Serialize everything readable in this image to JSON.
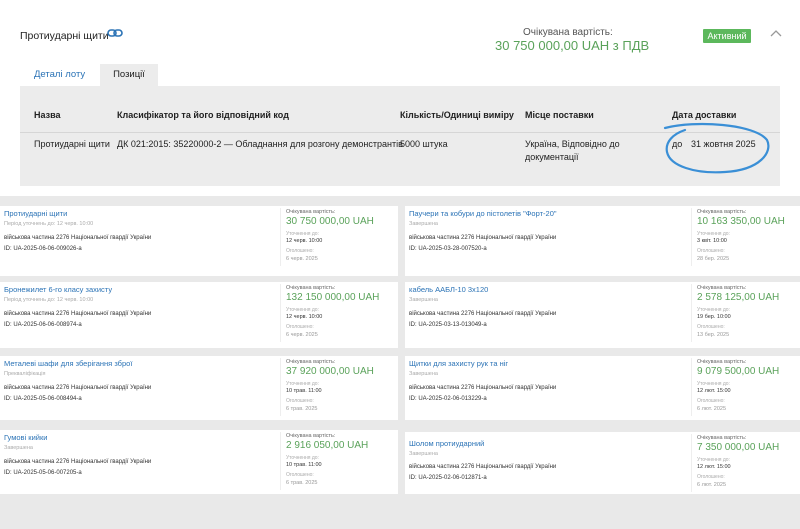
{
  "lot": {
    "title": "Протиударні щити",
    "price_caption": "Очікувана вартість:",
    "price_value": "30 750 000,00 UAH з ПДВ",
    "status": "Активний",
    "tabs": [
      "Деталі лоту",
      "Позиції"
    ],
    "table": {
      "headers": [
        "Назва",
        "Класифікатор та його відповідний код",
        "Кількість/Одиниці виміру",
        "Місце поставки",
        "Дата доставки"
      ],
      "row": {
        "name": "Протиударні щити",
        "classifier": "ДК 021:2015: 35220000-2 — Обладнання для розгону демонстрантів",
        "quantity": "5000 штука",
        "place_line1": "Україна, Відповідно до",
        "place_line2": "документації",
        "date_prefix": "до",
        "date": "31 жовтня 2025"
      }
    }
  },
  "results": [
    {
      "title": "Протиударні щити",
      "subtitle": "Період уточнень до: 12 черв. 10:00",
      "org": "військова частина 2276 Національної гвардії України",
      "id": "ID: UA-2025-06-06-009026-a",
      "price_caption": "Очікувана вартість:",
      "price": "30 750 000,00 UAH",
      "label1": "Уточнення до:",
      "date1": "12 черв. 10:00",
      "label2": "Оголошено:",
      "date2": "6 черв. 2025"
    },
    {
      "title": "Паучери та кобури до пістолетів \"Форт-20\"",
      "subtitle": "Завершена",
      "org": "військова частина 2276 Національної гвардії України",
      "id": "ID: UA-2025-03-28-007520-a",
      "price_caption": "Очікувана вартість:",
      "price": "10 163 350,00 UAH",
      "label1": "Уточнення до:",
      "date1": "3 квіт. 10:00",
      "label2": "Оголошено:",
      "date2": "28 бер. 2025"
    },
    {
      "title": "Бронежилет 6-го класу захисту",
      "subtitle": "Період уточнень до: 12 черв. 10:00",
      "org": "військова частина 2276 Національної гвардії України",
      "id": "ID: UA-2025-06-06-008974-a",
      "price_caption": "Очікувана вартість:",
      "price": "132 150 000,00 UAH",
      "label1": "Уточнення до:",
      "date1": "12 черв. 10:00",
      "label2": "Оголошено:",
      "date2": "6 черв. 2025"
    },
    {
      "title": "кабель ААБЛ-10 3х120",
      "subtitle": "Завершена",
      "org": "військова частина 2276 Національної гвардії України",
      "id": "ID: UA-2025-03-13-013049-a",
      "price_caption": "Очікувана вартість:",
      "price": "2 578 125,00 UAH",
      "label1": "Уточнення до:",
      "date1": "19 бер. 10:00",
      "label2": "Оголошено:",
      "date2": "13 бер. 2025"
    },
    {
      "title": "Металеві шафи для зберігання зброї",
      "subtitle": "Прекваліфікація",
      "org": "військова частина 2276 Національної гвардії України",
      "id": "ID: UA-2025-05-06-008494-a",
      "price_caption": "Очікувана вартість:",
      "price": "37 920 000,00 UAH",
      "label1": "Уточнення до:",
      "date1": "10 трав. 11:00",
      "label2": "Оголошено:",
      "date2": "6 трав. 2025"
    },
    {
      "title": "Щитки для захисту рук та ніг",
      "subtitle": "Завершена",
      "org": "військова частина 2276 Національної гвардії України",
      "id": "ID: UA-2025-02-06-013229-a",
      "price_caption": "Очікувана вартість:",
      "price": "9 079 500,00 UAH",
      "label1": "Уточнення до:",
      "date1": "12 лют. 15:00",
      "label2": "Оголошено:",
      "date2": "6 лют. 2025"
    },
    {
      "title": "Гумові кийки",
      "subtitle": "Завершена",
      "org": "військова частина 2276 Національної гвардії України",
      "id": "ID: UA-2025-05-06-007205-a",
      "price_caption": "Очікувана вартість:",
      "price": "2 916 050,00 UAH",
      "label1": "Уточнення до:",
      "date1": "10 трав. 11:00",
      "label2": "Оголошено:",
      "date2": "6 трав. 2025"
    },
    {
      "title": "Шолом протиударний",
      "subtitle": "Завершена",
      "org": "військова частина 2276 Національної гвардії України",
      "id": "ID: UA-2025-02-06-012871-a",
      "price_caption": "Очікувана вартість:",
      "price": "7 350 000,00 UAH",
      "label1": "Уточнення до:",
      "date1": "12 лют. 15:00",
      "label2": "Оголошено:",
      "date2": "6 лют. 2025"
    }
  ]
}
